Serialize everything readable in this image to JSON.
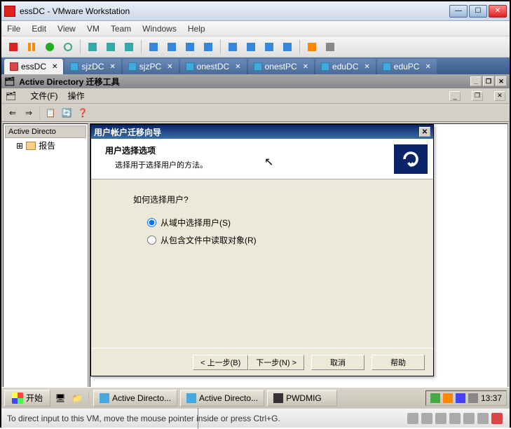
{
  "vmware": {
    "title": "essDC - VMware Workstation",
    "menu": [
      "File",
      "Edit",
      "View",
      "VM",
      "Team",
      "Windows",
      "Help"
    ],
    "tabs": [
      {
        "label": "essDC",
        "active": true
      },
      {
        "label": "sjzDC",
        "active": false
      },
      {
        "label": "sjzPC",
        "active": false
      },
      {
        "label": "onestDC",
        "active": false
      },
      {
        "label": "onestPC",
        "active": false
      },
      {
        "label": "eduDC",
        "active": false
      },
      {
        "label": "eduPC",
        "active": false
      }
    ],
    "status": "To direct input to this VM, move the mouse pointer inside or press Ctrl+G."
  },
  "guest": {
    "title": "Active Directory 迁移工具",
    "menu": {
      "file": "文件(F)",
      "action": "操作"
    },
    "tree": {
      "root": "Active Directo",
      "child": "报告"
    },
    "taskbar": {
      "start": "开始",
      "tasks": [
        "Active Directo...",
        "Active Directo...",
        "PWDMIG"
      ],
      "clock": "13:37"
    }
  },
  "wizard": {
    "title": "用户帐户迁移向导",
    "header_title": "用户选择选项",
    "header_sub": "选择用于选择用户的方法。",
    "question": "如何选择用户?",
    "option1": "从域中选择用户(S)",
    "option2": "从包含文件中读取对象(R)",
    "btn_back": "< 上一步(B)",
    "btn_next": "下一步(N) >",
    "btn_cancel": "取消",
    "btn_help": "帮助"
  }
}
